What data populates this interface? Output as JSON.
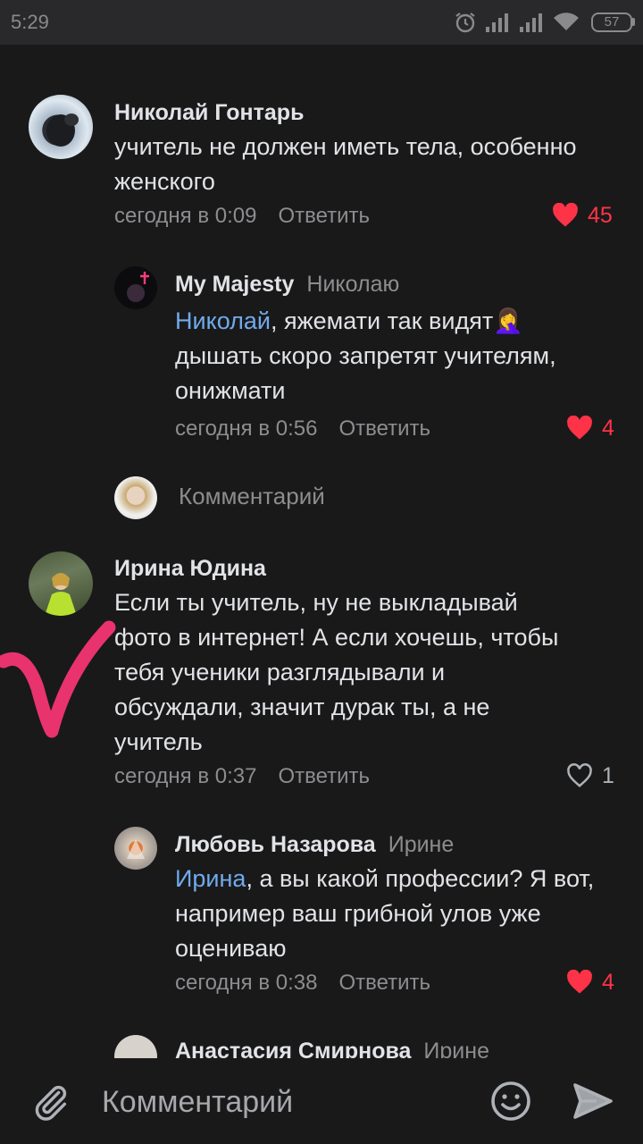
{
  "status_bar": {
    "time": "5:29",
    "battery": "57"
  },
  "comments": [
    {
      "author": "Николай Гонтарь",
      "text": "учитель не должен иметь тела, особенно женского",
      "date": "сегодня в 0:09",
      "reply_label": "Ответить",
      "likes": "45",
      "liked": true
    },
    {
      "author": "My Majesty",
      "reply_to": "Николаю",
      "mention": "Николай",
      "text": ", яжемати так видят🤦‍♀️ дышать скоро запретят учителям, онижмати",
      "date": "сегодня в 0:56",
      "reply_label": "Ответить",
      "likes": "4",
      "liked": true
    },
    {
      "author": "Ирина Юдина",
      "text": "Если ты учитель, ну не выкладывай фото в интернет! А если хочешь, чтобы тебя ученики разглядывали и обсуждали, значит дурак ты, а не учитель",
      "date": "сегодня в 0:37",
      "reply_label": "Ответить",
      "likes": "1",
      "liked": false
    },
    {
      "author": "Любовь Назарова",
      "reply_to": "Ирине",
      "mention": "Ирина",
      "text": ", а вы какой профессии? Я вот, например ваш грибной улов уже оцениваю",
      "date": "сегодня в 0:38",
      "reply_label": "Ответить",
      "likes": "4",
      "liked": true
    },
    {
      "author": "Анастасия Смирнова",
      "reply_to": "Ирине"
    }
  ],
  "inline_reply": {
    "placeholder": "Комментарий"
  },
  "composer": {
    "placeholder": "Комментарий",
    "icons": [
      "paperclip-icon",
      "smiley-icon",
      "send-icon"
    ]
  },
  "colors": {
    "background": "#19191a",
    "link": "#71aaeb",
    "like_active": "#ff3347",
    "secondary_text": "#8d8d90",
    "annotation": "#e8336f"
  }
}
